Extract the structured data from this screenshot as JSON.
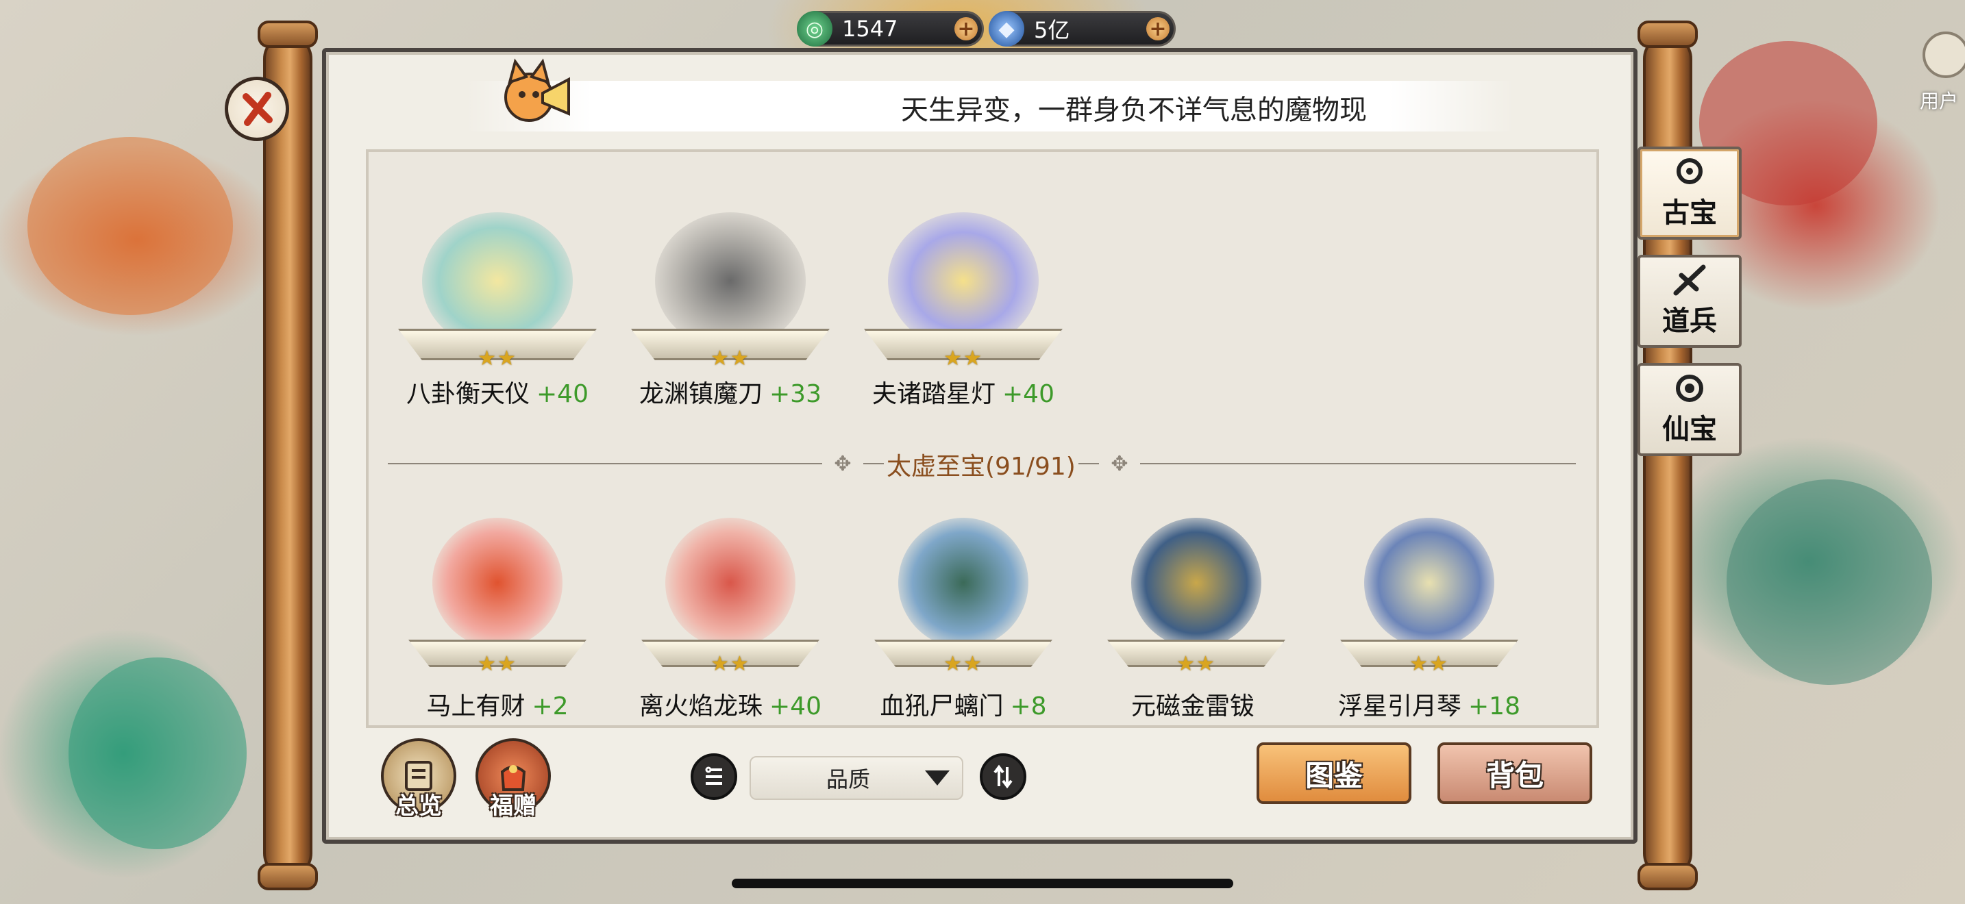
{
  "currencies": [
    {
      "icon": "jade-coin-icon",
      "value": "1547",
      "color": "#3fae6a"
    },
    {
      "icon": "blue-crystal-icon",
      "value": "5亿",
      "color": "#3d7fd6"
    }
  ],
  "notice": {
    "text": "天生异变，一群身负不详气息的魔物现"
  },
  "side_tabs": [
    {
      "label": "古宝",
      "active": true
    },
    {
      "label": "道兵",
      "active": false
    },
    {
      "label": "仙宝",
      "active": false
    }
  ],
  "user_corner": {
    "label": "用户"
  },
  "top_items": [
    {
      "name": "八卦衡天仪",
      "level": "+40",
      "stars": "★★",
      "color": "#9fd3c9"
    },
    {
      "name": "龙渊镇魔刀",
      "level": "+33",
      "stars": "★★",
      "color": "#b9b6b0"
    },
    {
      "name": "夫诸踏星灯",
      "level": "+40",
      "stars": "★★",
      "color": "#a8a8e8"
    }
  ],
  "section": {
    "title": "太虚至宝(91/91)"
  },
  "bottom_items": [
    {
      "name": "马上有财",
      "level": "+2",
      "stars": "★★",
      "color": "#f2a9a0"
    },
    {
      "name": "离火焰龙珠",
      "level": "+40",
      "stars": "★★",
      "color": "#f0b3a8"
    },
    {
      "name": "血犼尸螭门",
      "level": "+8",
      "stars": "★★",
      "color": "#7fa7c9"
    },
    {
      "name": "元磁金雷钹",
      "level": "",
      "stars": "★★",
      "color": "#3f5f86"
    },
    {
      "name": "浮星引月琴",
      "level": "+18",
      "stars": "★★",
      "color": "#6b84b8"
    }
  ],
  "bottom_bar": {
    "overview_label": "总览",
    "gift_label": "福赠",
    "sort_select_value": "品质",
    "codex_label": "图鉴",
    "bag_label": "背包"
  }
}
